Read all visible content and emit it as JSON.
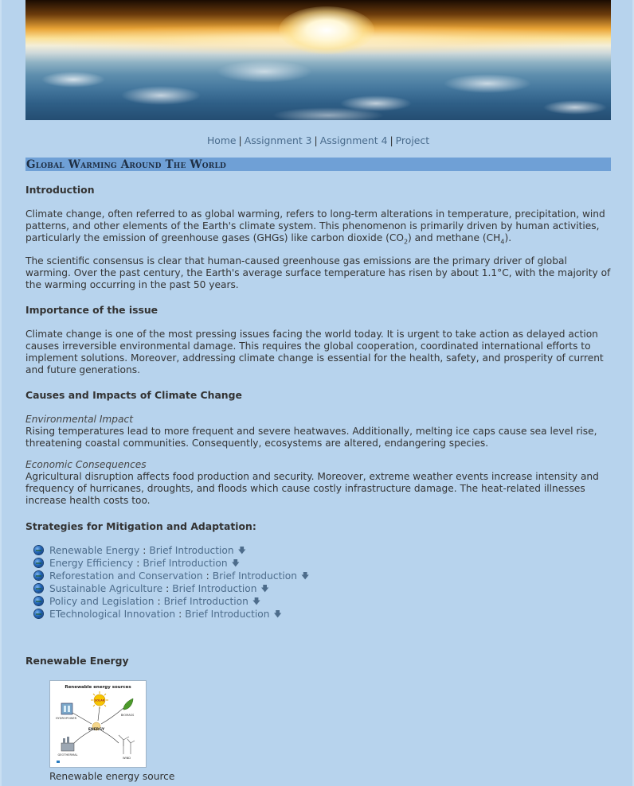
{
  "nav": {
    "items": [
      "Home",
      "Assignment 3",
      "Assignment 4",
      "Project"
    ],
    "separator": "|"
  },
  "page_title": "Global Warming Around The World",
  "intro": {
    "heading": "Introduction",
    "p1_a": "Climate change, often referred to as global warming, refers to long-term alterations in temperature, precipitation, wind patterns, and other elements of the Earth's climate system. This phenomenon is primarily driven by human activities, particularly the emission of greenhouse gases (GHGs) like carbon dioxide (CO",
    "p1_sub1": "2",
    "p1_b": ") and methane (CH",
    "p1_sub2": "4",
    "p1_c": ").",
    "p2": "The scientific consensus is clear that human-caused greenhouse gas emissions are the primary driver of global warming. Over the past century, the Earth's average surface temperature has risen by about 1.1°C, with the majority of the warming occurring in the past 50 years."
  },
  "importance": {
    "heading": "Importance of the issue",
    "p": "Climate change is one of the most pressing issues facing the world today. It is urgent to take action as delayed action causes irreversible environmental damage. This requires the global cooperation, coordinated international efforts to implement solutions. Moreover, addressing climate change is essential for the health, safety, and prosperity of current and future generations."
  },
  "causes": {
    "heading": "Causes and Impacts of Climate Change",
    "env_label": "Environmental Impact",
    "env_text": "Rising temperatures lead to more frequent and severe heatwaves. Additionally, melting ice caps cause sea level rise, threatening coastal communities. Consequently, ecosystems are altered, endangering species.",
    "econ_label": "Economic Consequences",
    "econ_text": "Agricultural disruption affects food production and security. Moreover, extreme weather events increase intensity and frequency of hurricanes, droughts, and floods which cause costly infrastructure damage. The heat-related illnesses increase health costs too."
  },
  "strategies": {
    "heading": "Strategies for Mitigation and Adaptation:",
    "items": [
      {
        "name": "Renewable Energy",
        "link": "Brief Introduction"
      },
      {
        "name": "Energy Efficiency",
        "link": "Brief Introduction"
      },
      {
        "name": "Reforestation and Conservation",
        "link": "Brief Introduction"
      },
      {
        "name": "Sustainable Agriculture",
        "link": "Brief Introduction"
      },
      {
        "name": "Policy and Legislation",
        "link": "Brief Introduction"
      },
      {
        "name": "ETechnological Innovation",
        "link": "Brief Introduction"
      }
    ],
    "bullet_icon": "globe-icon",
    "link_icon": "down-arrow-icon"
  },
  "renewable": {
    "heading": "Renewable Energy",
    "figure_title": "Renewable energy sources",
    "figure_labels": [
      "HYDROPOWER",
      "SOLAR",
      "BIOMASS",
      "ENERGY",
      "GEOTHERMAL",
      "WIND"
    ],
    "caption": "Renewable energy source"
  },
  "colors": {
    "background": "#b7d3ed",
    "title_bar": "#6fa0d6",
    "link": "#496b8c"
  }
}
